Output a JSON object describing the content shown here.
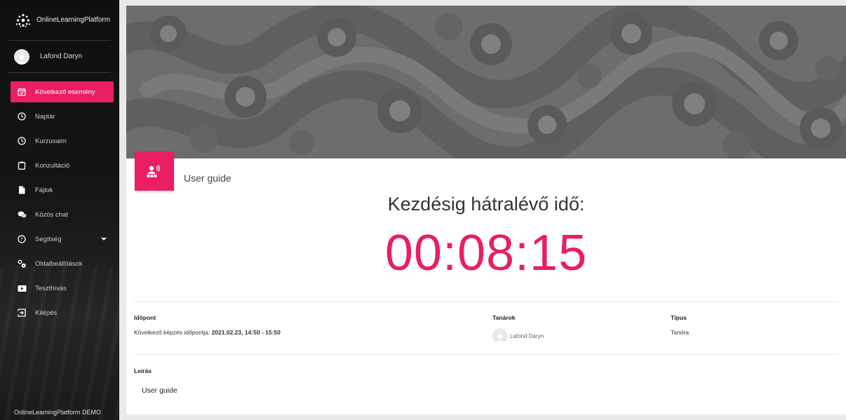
{
  "app": {
    "name": "OnlineLearningPlatform",
    "footer": "OnlineLearningPlatform DEMO"
  },
  "user": {
    "name": "Lafond Daryn"
  },
  "nav": [
    {
      "label": "Következő esemény",
      "icon": "calendar-check-icon",
      "active": true
    },
    {
      "label": "Naptár",
      "icon": "clock-icon"
    },
    {
      "label": "Kurzusaim",
      "icon": "clock-icon"
    },
    {
      "label": "Konzultáció",
      "icon": "clipboard-icon"
    },
    {
      "label": "Fájlok",
      "icon": "file-icon"
    },
    {
      "label": "Közös chat",
      "icon": "chat-icon"
    },
    {
      "label": "Segítség",
      "icon": "help-icon",
      "dropdown": true
    },
    {
      "label": "Oldalbeállítások",
      "icon": "gears-icon"
    },
    {
      "label": "Teszthívás",
      "icon": "video-icon"
    },
    {
      "label": "Kilépés",
      "icon": "exit-icon"
    }
  ],
  "event": {
    "title": "User guide",
    "countdown_label": "Kezdésig hátralévő idő:",
    "countdown": "00:08:15"
  },
  "details": {
    "time_header": "Időpont",
    "time_prefix": "Következő képzés időpontja: ",
    "time_value": "2021.02.23, 14:50 - 15:50",
    "teachers_header": "Tanárok",
    "teacher_name": "Lafond Daryn",
    "type_header": "Típus",
    "type_value": "Tanóra",
    "description_header": "Leírás",
    "description_value": "User guide"
  },
  "colors": {
    "accent": "#e91e63",
    "sidebar_bg": "#151515",
    "hero_bg": "#6c6c6c"
  }
}
